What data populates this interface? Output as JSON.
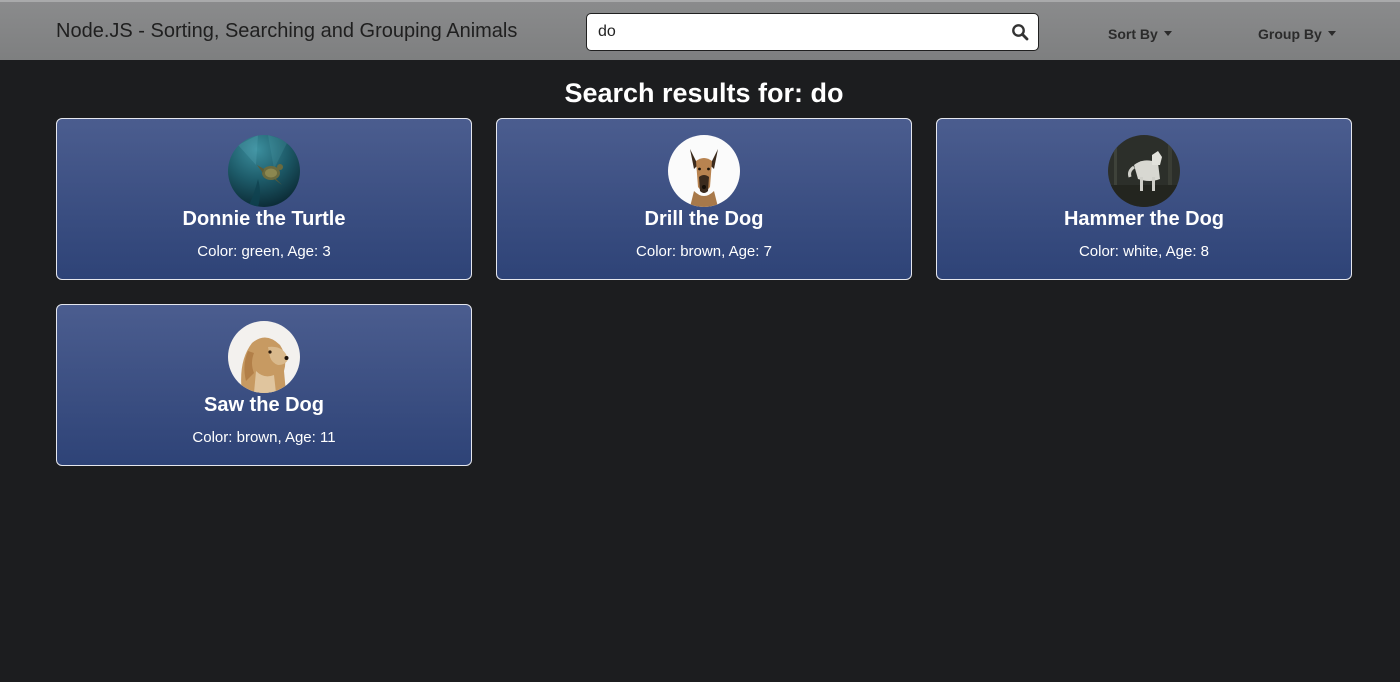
{
  "navbar": {
    "brand": "Node.JS - Sorting, Searching and Grouping Animals",
    "search": {
      "value": "do",
      "placeholder": ""
    },
    "sort_label": "Sort By",
    "group_label": "Group By"
  },
  "results": {
    "title": "Search results for: do",
    "cards": [
      {
        "name": "Donnie the Turtle",
        "info": "Color: green, Age: 3"
      },
      {
        "name": "Drill the Dog",
        "info": "Color: brown, Age: 7"
      },
      {
        "name": "Hammer the Dog",
        "info": "Color: white, Age: 8"
      },
      {
        "name": "Saw the Dog",
        "info": "Color: brown, Age: 11"
      }
    ]
  },
  "colors": {
    "page_bg": "#1c1d1f",
    "navbar_bg": "#858687",
    "card_top": "#4b5d8f",
    "card_bottom": "#2e4377"
  }
}
